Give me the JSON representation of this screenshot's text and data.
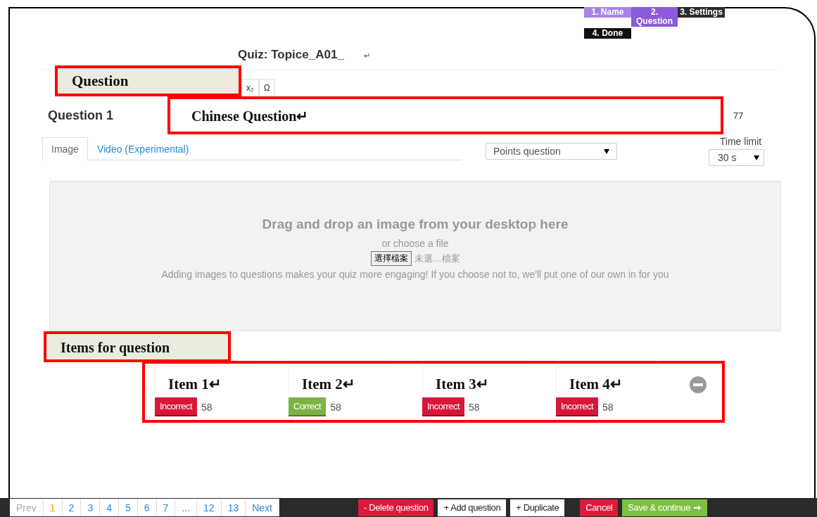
{
  "steps": [
    {
      "label": "1. Name",
      "completed": true,
      "selected": false
    },
    {
      "label": "2. Question",
      "completed": false,
      "selected": true
    },
    {
      "label": "3. Settings",
      "completed": false,
      "selected": false
    },
    {
      "label": "4. Done",
      "completed": false,
      "selected": false
    }
  ],
  "quiz_title": "Quiz: Topice_A01_",
  "title_mark": "↵",
  "question_label": "Question",
  "toolbar": [
    "x₂",
    "Ω"
  ],
  "question_number": "Question 1",
  "question_field": {
    "value": "Chinese Question↵",
    "char_count": "77"
  },
  "media_tabs": [
    {
      "label": "Image",
      "selected": true
    },
    {
      "label": "Video (Experimental)",
      "selected": false
    }
  ],
  "question_type": "Points question",
  "time_limit": {
    "label": "Time limit",
    "value": "30 s"
  },
  "dropzone": {
    "heading": "Drag and drop an image from your desktop here",
    "subheading": "or choose a file",
    "file_button": "選擇檔案",
    "file_status": "未選…檔案",
    "hint": "Adding images to questions makes your quiz more engaging! If you choose not to, we'll put one of our own in for you"
  },
  "items_label": "Items for question",
  "answers": [
    {
      "text": "Item 1↵",
      "correct": false,
      "status_label": "Incorrect",
      "count": "58"
    },
    {
      "text": "Item 2↵",
      "correct": true,
      "status_label": "Correct",
      "count": "58"
    },
    {
      "text": "Item 3↵",
      "correct": false,
      "status_label": "Incorrect",
      "count": "58"
    },
    {
      "text": "Item 4↵",
      "correct": false,
      "status_label": "Incorrect",
      "count": "58"
    }
  ],
  "pagination": {
    "prev": {
      "label": "Prev",
      "disabled": true
    },
    "pages": [
      {
        "label": "1",
        "selected": true
      },
      {
        "label": "2",
        "selected": false
      },
      {
        "label": "3",
        "selected": false
      },
      {
        "label": "4",
        "selected": false
      },
      {
        "label": "5",
        "selected": false
      },
      {
        "label": "6",
        "selected": false
      },
      {
        "label": "7",
        "selected": false
      },
      {
        "label": "...",
        "selected": false
      },
      {
        "label": "12",
        "selected": false
      },
      {
        "label": "13",
        "selected": false
      }
    ],
    "next": {
      "label": "Next",
      "disabled": false
    }
  },
  "actions": [
    {
      "label": "- Delete question",
      "kind": "danger"
    },
    {
      "label": "+ Add question",
      "kind": "plain"
    },
    {
      "label": "+ Duplicate",
      "kind": "plain"
    },
    {
      "label": "Cancel",
      "kind": "danger"
    },
    {
      "label": "Save & continue",
      "kind": "primary"
    }
  ]
}
